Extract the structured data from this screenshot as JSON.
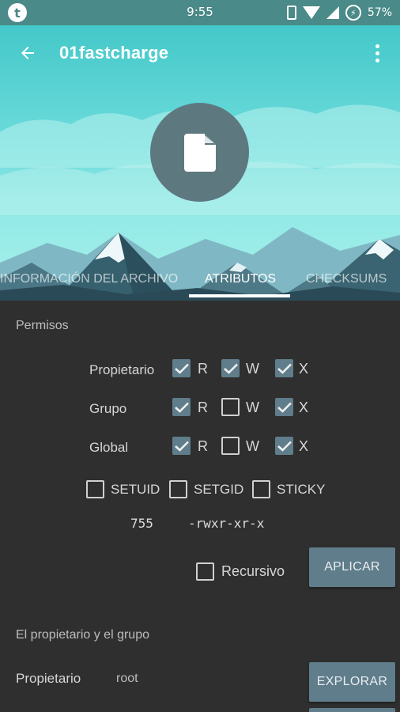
{
  "status_bar": {
    "time": "9:55",
    "battery": "57%",
    "app_badge": "t"
  },
  "toolbar": {
    "title": "01fastcharge"
  },
  "tabs": [
    {
      "label": "INFORMACIÓN DEL ARCHIVO"
    },
    {
      "label": "ATRIBUTOS",
      "active": true
    },
    {
      "label": "CHECKSUMS"
    }
  ],
  "permissions": {
    "section_title": "Permisos",
    "rows": [
      {
        "label": "Propietario",
        "r": true,
        "w": true,
        "x": true
      },
      {
        "label": "Grupo",
        "r": true,
        "w": false,
        "x": true
      },
      {
        "label": "Global",
        "r": true,
        "w": false,
        "x": true
      }
    ],
    "letters": {
      "r": "R",
      "w": "W",
      "x": "X"
    },
    "flags": [
      {
        "label": "SETUID",
        "checked": false
      },
      {
        "label": "SETGID",
        "checked": false
      },
      {
        "label": "STICKY",
        "checked": false
      }
    ],
    "octal": "755",
    "symbolic": "-rwxr-xr-x",
    "recursive_label": "Recursivo",
    "recursive_checked": false,
    "apply_label": "APLICAR"
  },
  "ownership": {
    "section_title": "El propietario y el grupo",
    "owner_label": "Propietario",
    "owner_value": "root",
    "browse_label": "EXPLORAR"
  },
  "colors": {
    "accent": "#607d8b",
    "status_bar": "#4a8a88",
    "background": "#2f2f2f"
  }
}
